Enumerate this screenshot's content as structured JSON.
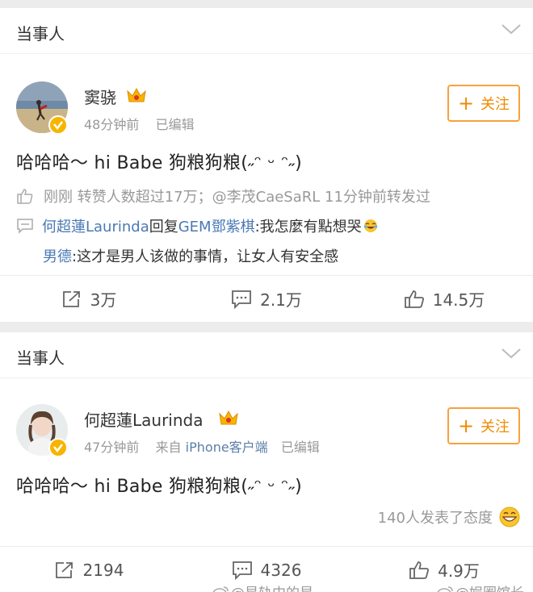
{
  "cards": [
    {
      "section_title": "当事人",
      "author": "窦骁",
      "meta_time": "48分钟前",
      "meta_edit": "已编辑",
      "follow_label": "关注",
      "post_text": "哈哈哈～ hi Babe 狗粮狗粮(˶ᵔ ᵕ ᵔ˶)",
      "repost_info": "刚刚 转赞人数超过17万；@李茂CaeSaRL 11分钟前转发过",
      "comment1": {
        "author": "何超蓮Laurinda",
        "verb": "回复",
        "target": "GEM鄧紫棋",
        "text": ":我怎麼有點想哭"
      },
      "comment2": {
        "author": "男德",
        "text": ":这才是男人该做的事情，让女人有安全感"
      },
      "actions": {
        "repost": "3万",
        "comment": "2.1万",
        "like": "14.5万"
      }
    },
    {
      "section_title": "当事人",
      "author": "何超蓮Laurinda",
      "meta_time": "47分钟前",
      "meta_source_prefix": "来自",
      "meta_source": "iPhone客户端",
      "meta_edit": "已编辑",
      "follow_label": "关注",
      "post_text": "哈哈哈～ hi Babe 狗粮狗粮(˶ᵔ ᵕ ᵔ˶)",
      "reaction_text": "140人发表了态度",
      "actions": {
        "repost": "2194",
        "comment": "4326",
        "like": "4.9万"
      }
    }
  ],
  "watermarks": [
    "@星轨中的星",
    "@娱圈馆长"
  ],
  "colors": {
    "accent_orange": "#f08a00",
    "link_blue": "#4a79b5",
    "badge_gold": "#f7b500"
  }
}
